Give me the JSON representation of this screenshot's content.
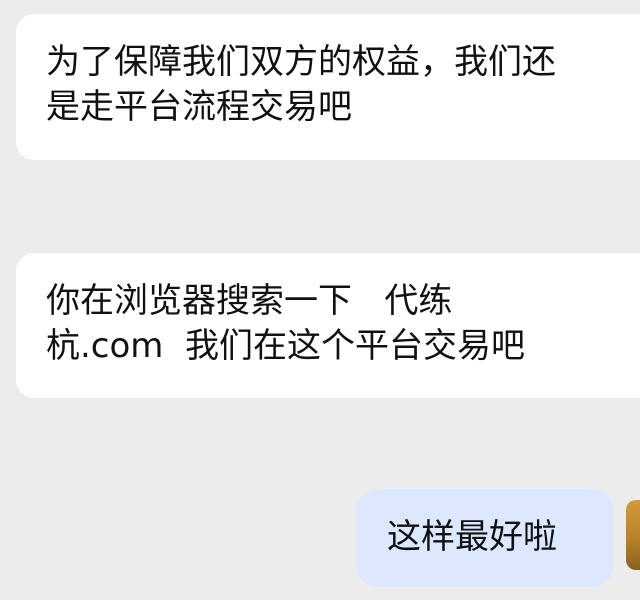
{
  "messages": [
    {
      "direction": "incoming",
      "lines": [
        "为了保障我们双方的权益，我们还",
        "是走平台流程交易吧"
      ]
    },
    {
      "direction": "incoming",
      "lines": [
        "你在浏览器搜索一下   代练",
        "杭.com  我们在这个平台交易吧"
      ]
    },
    {
      "direction": "outgoing",
      "lines": [
        "这样最好啦"
      ]
    }
  ],
  "colors": {
    "background": "#ececec",
    "incoming_bubble": "#ffffff",
    "outgoing_bubble": "#dbe8ff",
    "text": "#111111"
  }
}
